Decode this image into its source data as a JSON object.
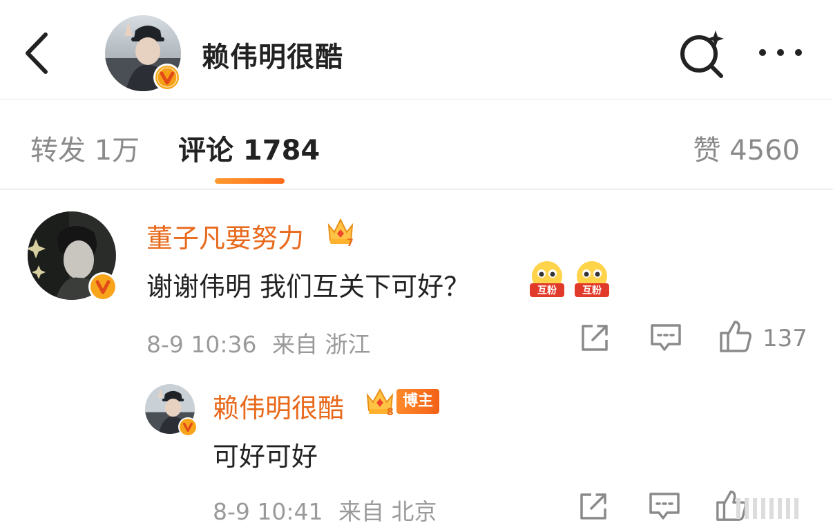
{
  "header": {
    "title": "赖伟明很酷",
    "back_icon": "chevron-left-icon",
    "search_icon": "search-sparkle-icon",
    "more_icon": "more-horizontal-icon"
  },
  "tabs": {
    "repost": "转发 1万",
    "comment": "评论 1784",
    "like": "赞 4560"
  },
  "colors": {
    "accent": "#ff7a1f",
    "name": "#e8691b",
    "muted": "#9a9a9a",
    "verified": "#f7a51b"
  },
  "comments": [
    {
      "name": "董子凡要努力",
      "text": "谢谢伟明 我们互关下可好？",
      "emoji_label": "互粉",
      "date": "8-9 10:36",
      "source": "来自 浙江",
      "likes": "137"
    },
    {
      "name": "赖伟明很酷",
      "author_tag": "博主",
      "text": "可好可好",
      "date": "8-9 10:41",
      "source": "来自 北京"
    }
  ]
}
